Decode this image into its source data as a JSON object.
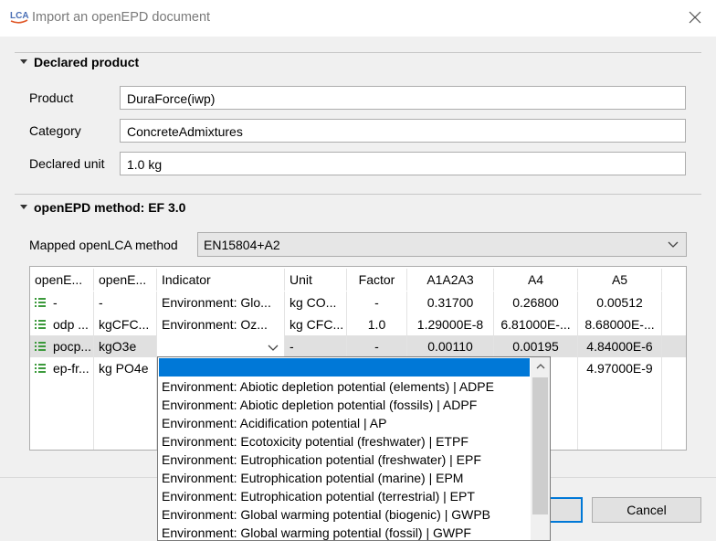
{
  "window": {
    "title": "Import an openEPD document",
    "app_icon": "lca-logo-icon",
    "close_icon": "close-icon"
  },
  "declared_product": {
    "heading": "Declared product",
    "fields": [
      {
        "label": "Product",
        "value": "DuraForce(iwp)"
      },
      {
        "label": "Category",
        "value": "ConcreteAdmixtures"
      },
      {
        "label": "Declared unit",
        "value": "1.0 kg"
      }
    ]
  },
  "method": {
    "heading": "openEPD method: EF 3.0",
    "mapped_label": "Mapped openLCA method",
    "mapped_value": "EN15804+A2"
  },
  "table": {
    "headers": [
      "openE...",
      "openE...",
      "Indicator",
      "Unit",
      "Factor",
      "A1A2A3",
      "A4",
      "A5"
    ],
    "rows": [
      {
        "c1": "-",
        "c2": "-",
        "indicator": "Environment: Glo...",
        "unit": "kg CO...",
        "factor": "-",
        "a1a2a3": "0.31700",
        "a4": "0.26800",
        "a5": "0.00512"
      },
      {
        "c1": "odp ...",
        "c2": "kgCFC...",
        "indicator": "Environment: Oz...",
        "unit": "kg CFC...",
        "factor": "1.0",
        "a1a2a3": "1.29000E-8",
        "a4": "6.81000E-...",
        "a5": "8.68000E-..."
      },
      {
        "c1": "pocp...",
        "c2": "kgO3e",
        "indicator": "",
        "unit": "-",
        "factor": "-",
        "a1a2a3": "0.00110",
        "a4": "0.00195",
        "a5": "4.84000E-6"
      },
      {
        "c1": "ep-fr...",
        "c2": "kg PO4e",
        "indicator": "",
        "unit": "",
        "factor": "",
        "a1a2a3": "",
        "a4": "",
        "a5": "4.97000E-9"
      }
    ]
  },
  "dropdown": {
    "selected": "",
    "options": [
      "Environment: Abiotic depletion potential (elements) | ADPE",
      "Environment: Abiotic depletion potential (fossils) | ADPF",
      "Environment: Acidification potential | AP",
      "Environment: Ecotoxicity potential (freshwater) | ETPF",
      "Environment: Eutrophication potential (freshwater) | EPF",
      "Environment: Eutrophication potential (marine) | EPM",
      "Environment: Eutrophication potential (terrestrial) | EPT",
      "Environment: Global warming potential (biogenic) | GWPB",
      "Environment: Global warming potential (fossil) | GWPF"
    ]
  },
  "buttons": {
    "ok": "",
    "cancel": "Cancel"
  },
  "colors": {
    "accent": "#0078d7",
    "row_selected": "#e0e0e0",
    "icon_green": "#3c9a3c"
  }
}
